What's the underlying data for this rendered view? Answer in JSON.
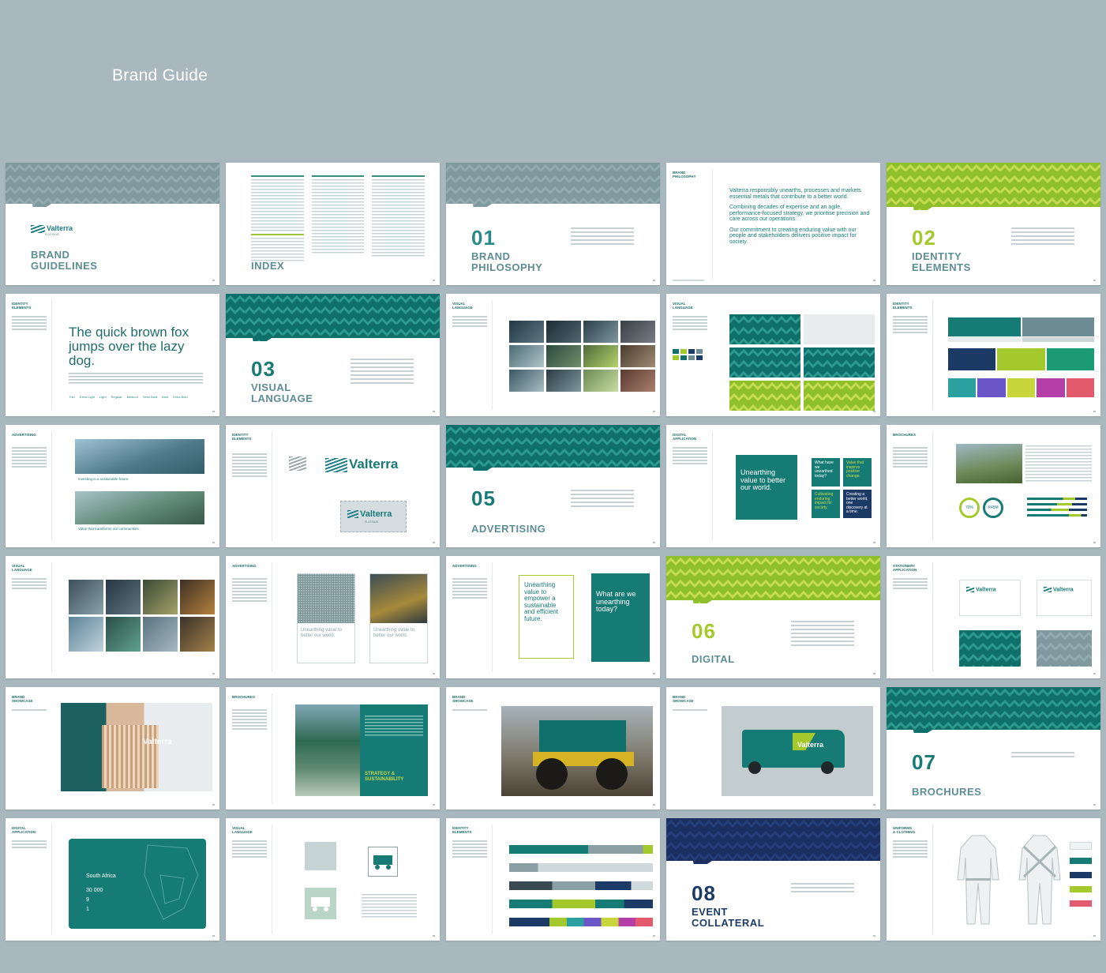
{
  "header": {
    "title": "Brand Guide"
  },
  "colors": {
    "background": "#a9b8bf",
    "teal": "#167a75",
    "lime": "#a3c92d",
    "navy": "#1b3a66",
    "grey_blue": "#6e8c94"
  },
  "pages": {
    "p1": {
      "title": "BRAND\nGUIDELINES",
      "logo": "Valterra",
      "logo_sub": "PLATINUM"
    },
    "p2": {
      "title": "INDEX"
    },
    "p3": {
      "num": "01",
      "name": "BRAND\nPHILOSOPHY"
    },
    "p4": {
      "heading": "BRAND\nPHILOSOPHY",
      "quote1": "Valterra responsibly unearths, processes and markets essential metals that contribute to a better world.",
      "quote2": "Combining decades of expertise and an agile, performance-focused strategy, we prioritise precision and care across our operations.",
      "quote3": "Our commitment to creating enduring value with our people and stakeholders delivers positive impact for society."
    },
    "p5": {
      "num": "02",
      "name": "IDENTITY\nELEMENTS"
    },
    "p6": {
      "heading": "IDENTITY\nELEMENTS",
      "sample": "The quick brown fox jumps over the lazy dog.",
      "weights": [
        "Thin",
        "Extra Light",
        "Light",
        "Regular",
        "Medium",
        "Semi Bold",
        "Bold",
        "Extra Bold"
      ]
    },
    "p7": {
      "num": "03",
      "name": "VISUAL\nLANGUAGE"
    },
    "p8": {
      "heading": "VISUAL\nLANGUAGE"
    },
    "p9": {
      "heading": "VISUAL\nLANGUAGE"
    },
    "p10": {
      "heading": "IDENTITY\nELEMENTS"
    },
    "p11": {
      "heading": "ADVERTISING",
      "ad1": "Investing in a sustainable future.",
      "ad2": "Value that transforms our communities."
    },
    "p12": {
      "heading": "IDENTITY\nELEMENTS",
      "logo": "Valterra",
      "logo_sub": "PLATINUM"
    },
    "p13": {
      "num": "05",
      "name": "ADVERTISING"
    },
    "p14": {
      "heading": "DIGITAL\nAPPLICATION",
      "tile1": "Unearthing value to better our world.",
      "tile2": "What have we unearthed today?",
      "tile3": "Value that inspires positive change.",
      "tile4": "Cultivating enduring impact for society.",
      "tile5": "Creating a better world, one discovery at a time."
    },
    "p15": {
      "heading": "BROCHURES",
      "stat1": "70%",
      "stat2": "R45M"
    },
    "p16": {
      "heading": "VISUAL\nLANGUAGE"
    },
    "p17": {
      "heading": "ADVERTISING",
      "a1": "Unearthing value to better our world.",
      "a2": "Unearthing value to better our world."
    },
    "p18": {
      "heading": "ADVERTISING",
      "a1": "Unearthing value to empower a sustainable and efficient future.",
      "a2": "What are we unearthing today?"
    },
    "p19": {
      "num": "06",
      "name": "DIGITAL"
    },
    "p20": {
      "heading": "STATIONERY\nAPPLICATION",
      "logo": "Valterra"
    },
    "p21": {
      "heading": "BRAND\nSHOWCASE",
      "logo": "Valterra"
    },
    "p22": {
      "heading": "BROCHURES",
      "title": "STRATEGY & SUSTAINABILITY"
    },
    "p23": {
      "heading": "BRAND\nSHOWCASE"
    },
    "p24": {
      "heading": "BRAND\nSHOWCASE",
      "logo": "Valterra"
    },
    "p25": {
      "num": "07",
      "name": "BROCHURES"
    },
    "p26": {
      "heading": "DIGITAL\nAPPLICATION",
      "region": "South Africa",
      "stat1": "30 000",
      "stat2": "9",
      "stat3": "1"
    },
    "p27": {
      "heading": "VISUAL\nLANGUAGE"
    },
    "p28": {
      "heading": "IDENTITY\nELEMENTS"
    },
    "p29": {
      "num": "08",
      "name": "EVENT\nCOLLATERAL"
    },
    "p30": {
      "heading": "UNIFORMS\n& CLOTHING"
    }
  }
}
